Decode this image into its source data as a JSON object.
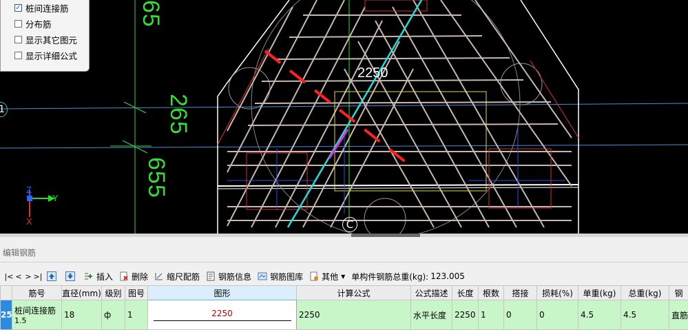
{
  "options": [
    {
      "label": "桩间连接筋",
      "checked": true
    },
    {
      "label": "分布筋",
      "checked": false
    },
    {
      "label": "显示其它图元",
      "checked": false
    },
    {
      "label": "显示详细公式",
      "checked": false
    }
  ],
  "cad": {
    "dim_label": "2250",
    "dims": [
      "65",
      "265",
      "655"
    ],
    "axis_marker_left": "1",
    "axis_marker_bottom": "C",
    "axes": {
      "z": "Z",
      "y": "Y",
      "x": "X"
    }
  },
  "panel": {
    "title": "编辑钢筋",
    "nav": [
      "|<",
      "<",
      ">",
      ">|"
    ],
    "toolbar": {
      "insert": "插入",
      "delete": "删除",
      "scale": "缩尺配筋",
      "info": "钢筋信息",
      "library": "钢筋图库",
      "other": "其他",
      "total_label": "单构件钢筋总重(kg):",
      "total_value": "123.005"
    },
    "columns": [
      "筋号",
      "直径(mm)",
      "级别",
      "图号",
      "图形",
      "计算公式",
      "公式描述",
      "长度",
      "根数",
      "搭接",
      "损耗(%)",
      "单重(kg)",
      "总重(kg)",
      "钢"
    ],
    "row": {
      "num": "25",
      "name": "桩间连接筋",
      "name_sub": "1.5",
      "diameter": "18",
      "grade": "ф",
      "fig": "1",
      "shape_value": "2250",
      "formula": "2250",
      "desc": "水平长度",
      "length": "2250",
      "count": "1",
      "lap": "0",
      "loss": "0",
      "unit_weight": "4.5",
      "total_weight": "4.5",
      "extra": "直筋"
    }
  }
}
